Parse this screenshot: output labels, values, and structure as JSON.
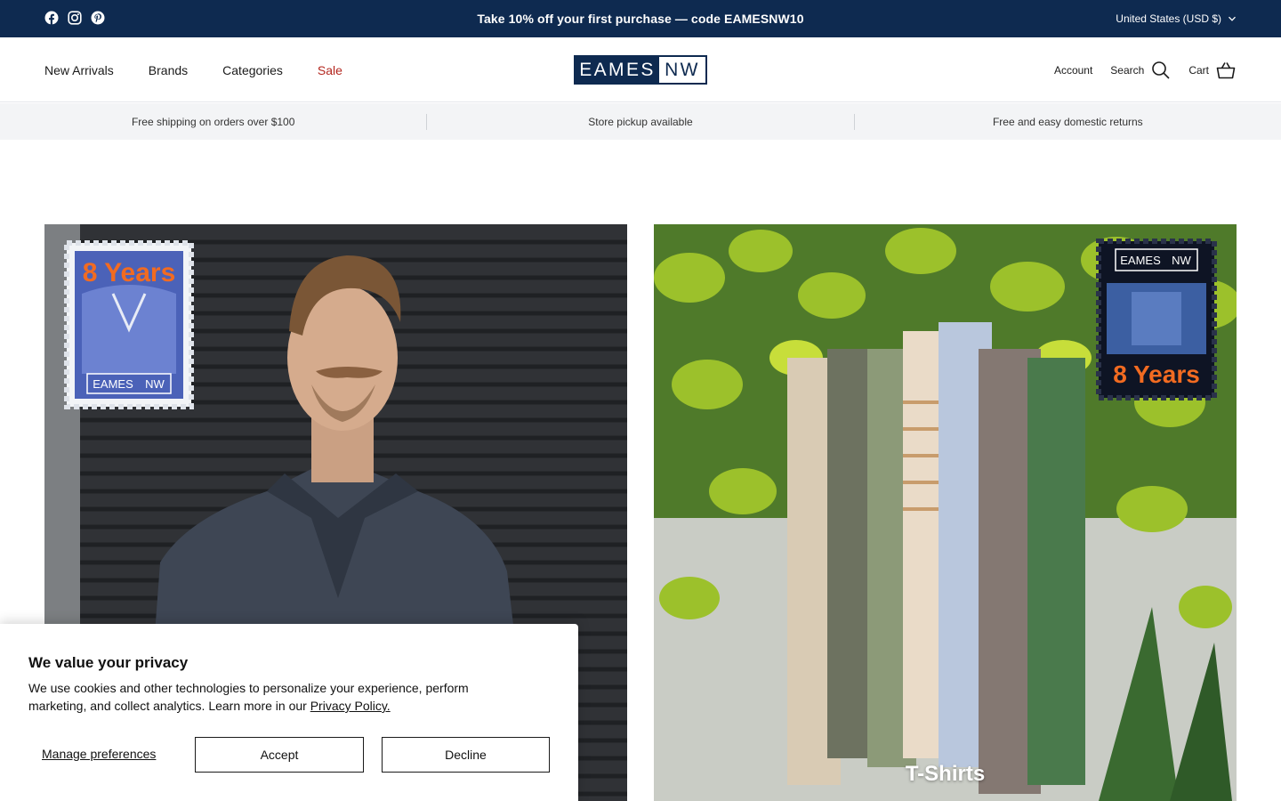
{
  "announcement": {
    "text": "Take 10% off your first purchase — code EAMESNW10",
    "currency": "United States (USD $)",
    "social": [
      "facebook-icon",
      "instagram-icon",
      "pinterest-icon"
    ],
    "bg_color": "#0e2a50"
  },
  "nav": {
    "items": [
      "New Arrivals",
      "Brands",
      "Categories",
      "Sale"
    ],
    "sale_color": "#b3261e"
  },
  "logo": {
    "left": "EAMES",
    "right": "NW"
  },
  "tools": {
    "account": "Account",
    "search": "Search",
    "cart": "Cart"
  },
  "usp": {
    "items": [
      "Free shipping on orders over $100",
      "Store pickup available",
      "Free and easy domestic returns"
    ]
  },
  "cards": {
    "left": {
      "stamp_title": "8 Years",
      "stamp_logo_left": "EAMES",
      "stamp_logo_right": "NW"
    },
    "right": {
      "caption": "T-Shirts",
      "stamp_title": "8 Years",
      "stamp_logo_left": "EAMES",
      "stamp_logo_right": "NW"
    }
  },
  "cookie": {
    "title": "We value your privacy",
    "body": "We use cookies and other technologies to personalize your experience, perform marketing, and collect analytics. Learn more in our",
    "link": "Privacy Policy.",
    "manage": "Manage preferences",
    "accept": "Accept",
    "decline": "Decline"
  }
}
